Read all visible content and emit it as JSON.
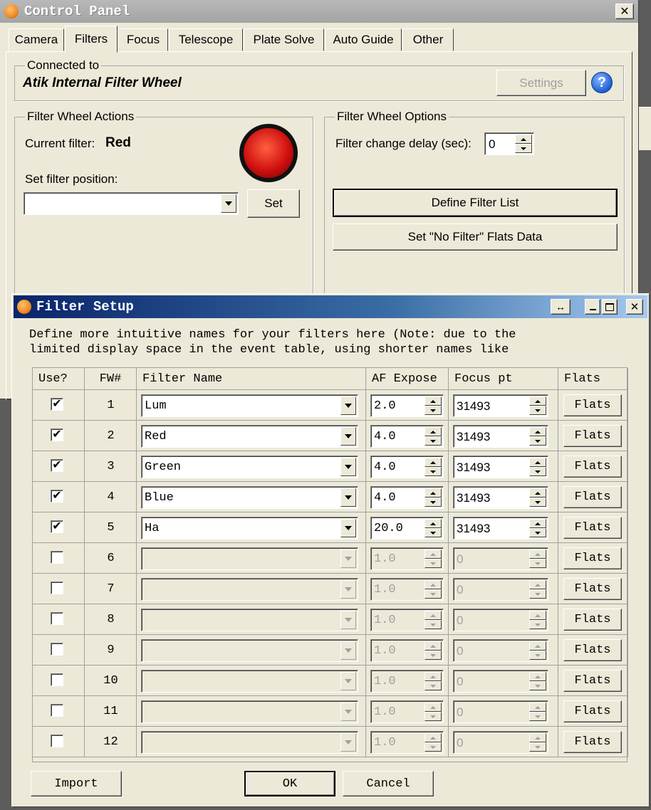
{
  "control_panel": {
    "title": "Control Panel",
    "close_glyph": "✕",
    "tabs": [
      "Camera",
      "Filters",
      "Focus",
      "Telescope",
      "Plate Solve",
      "Auto Guide",
      "Other"
    ],
    "active_tab": "Filters",
    "connected": {
      "label": "Connected to",
      "device": "Atik Internal Filter Wheel",
      "settings_btn": "Settings",
      "help_glyph": "?"
    },
    "actions": {
      "label": "Filter Wheel Actions",
      "current_filter_label": "Current filter:",
      "current_filter_value": "Red",
      "set_position_label": "Set filter position:",
      "set_btn": "Set",
      "led_color": "#d01010"
    },
    "options": {
      "label": "Filter Wheel Options",
      "delay_label": "Filter change delay (sec):",
      "delay_value": "0",
      "define_btn": "Define Filter List",
      "flats_btn": "Set \"No Filter\" Flats Data"
    }
  },
  "filter_setup": {
    "title": "Filter Setup",
    "desc_line1": "Define more intuitive names for your filters here (Note: due to the",
    "desc_line2": "limited display space in the event table, using shorter names like",
    "columns": {
      "use": "Use?",
      "fw": "FW#",
      "name": "Filter Name",
      "af": "AF Expose",
      "focus": "Focus pt",
      "flats": "Flats"
    },
    "rows": [
      {
        "use": true,
        "fw": "1",
        "name": "Lum",
        "af": "2.0",
        "focus": "31493",
        "flats": "Flats",
        "enabled": true
      },
      {
        "use": true,
        "fw": "2",
        "name": "Red",
        "af": "4.0",
        "focus": "31493",
        "flats": "Flats",
        "enabled": true
      },
      {
        "use": true,
        "fw": "3",
        "name": "Green",
        "af": "4.0",
        "focus": "31493",
        "flats": "Flats",
        "enabled": true
      },
      {
        "use": true,
        "fw": "4",
        "name": "Blue",
        "af": "4.0",
        "focus": "31493",
        "flats": "Flats",
        "enabled": true
      },
      {
        "use": true,
        "fw": "5",
        "name": "Ha",
        "af": "20.0",
        "focus": "31493",
        "flats": "Flats",
        "enabled": true
      },
      {
        "use": false,
        "fw": "6",
        "name": "",
        "af": "1.0",
        "focus": "0",
        "flats": "Flats",
        "enabled": false
      },
      {
        "use": false,
        "fw": "7",
        "name": "",
        "af": "1.0",
        "focus": "0",
        "flats": "Flats",
        "enabled": false
      },
      {
        "use": false,
        "fw": "8",
        "name": "",
        "af": "1.0",
        "focus": "0",
        "flats": "Flats",
        "enabled": false
      },
      {
        "use": false,
        "fw": "9",
        "name": "",
        "af": "1.0",
        "focus": "0",
        "flats": "Flats",
        "enabled": false
      },
      {
        "use": false,
        "fw": "10",
        "name": "",
        "af": "1.0",
        "focus": "0",
        "flats": "Flats",
        "enabled": false
      },
      {
        "use": false,
        "fw": "11",
        "name": "",
        "af": "1.0",
        "focus": "0",
        "flats": "Flats",
        "enabled": false
      },
      {
        "use": false,
        "fw": "12",
        "name": "",
        "af": "1.0",
        "focus": "0",
        "flats": "Flats",
        "enabled": false
      }
    ],
    "buttons": {
      "import": "Import",
      "ok": "OK",
      "cancel": "Cancel"
    }
  },
  "colors": {
    "title_active": "#0a246a",
    "title_inactive": "#9a9a9a",
    "dialog_bg": "#ece9d8",
    "app_icon": "#f08a24"
  }
}
